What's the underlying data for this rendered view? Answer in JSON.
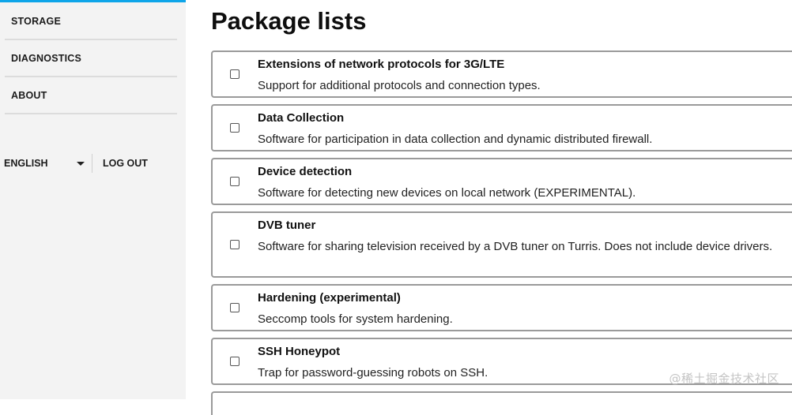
{
  "sidebar": {
    "items": [
      {
        "label": "STORAGE"
      },
      {
        "label": "DIAGNOSTICS"
      },
      {
        "label": "ABOUT"
      }
    ],
    "language": {
      "selected": "ENGLISH"
    },
    "logout_label": "LOG OUT",
    "accent_color": "#0ea5e9"
  },
  "main": {
    "title": "Package lists",
    "packages": [
      {
        "name": "Extensions of network protocols for 3G/LTE",
        "description": "Support for additional protocols and connection types.",
        "checked": false
      },
      {
        "name": "Data Collection",
        "description": "Software for participation in data collection and dynamic distributed firewall.",
        "checked": false
      },
      {
        "name": "Device detection",
        "description": "Software for detecting new devices on local network (EXPERIMENTAL).",
        "checked": false
      },
      {
        "name": "DVB tuner",
        "description": "Software for sharing television received by a DVB tuner on Turris. Does not include device drivers.",
        "checked": false
      },
      {
        "name": "Hardening (experimental)",
        "description": "Seccomp tools for system hardening.",
        "checked": false
      },
      {
        "name": "SSH Honeypot",
        "description": "Trap for password-guessing robots on SSH.",
        "checked": false
      }
    ]
  },
  "watermark": "@稀土掘金技术社区"
}
